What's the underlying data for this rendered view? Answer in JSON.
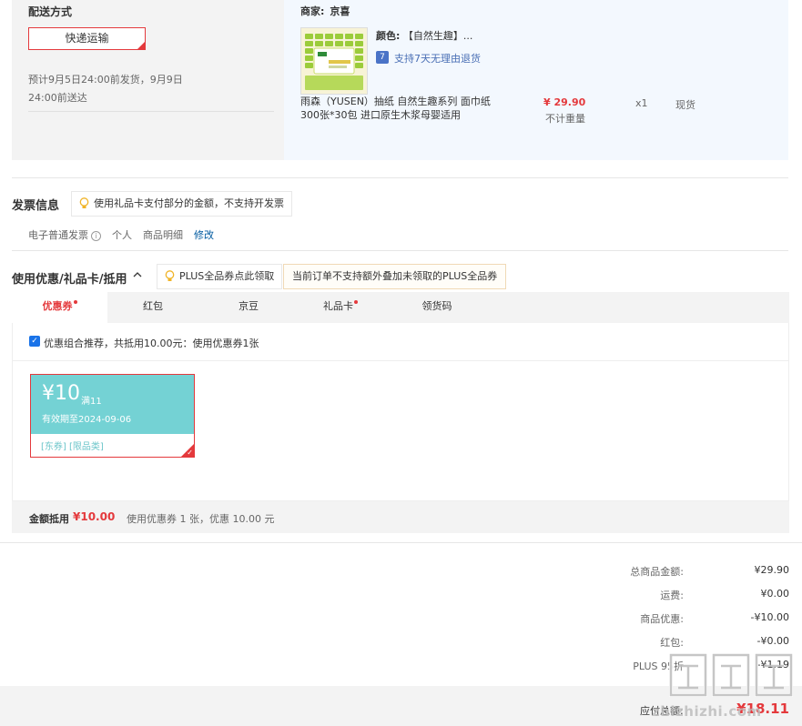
{
  "delivery": {
    "title": "配送方式",
    "method": "快递运输",
    "eta_line1": "预计9月5日24:00前发货，9月9日",
    "eta_line2": "24:00前送达"
  },
  "merchant": {
    "label": "商家:",
    "name": "京喜"
  },
  "product": {
    "color_label": "颜色:",
    "color_value": "【自然生趣】...",
    "return_icon": "7",
    "return_policy": "支持7天无理由退货",
    "name": "雨森（YUSEN）抽纸 自然生趣系列 面巾纸300张*30包 进口原生木浆母婴适用",
    "price": "¥ 29.90",
    "weight": "不计重量",
    "qty": "x1",
    "stock": "现货",
    "thumb_icon": "tissue-pack-image"
  },
  "invoice": {
    "title": "发票信息",
    "tip": "使用礼品卡支付部分的金额，不支持开发票",
    "type": "电子普通发票",
    "info_icon": "i",
    "holder": "个人",
    "content": "商品明细",
    "edit": "修改"
  },
  "coupons": {
    "title": "使用优惠/礼品卡/抵用",
    "plus_tip": "PLUS全品券点此领取",
    "plus_notice": "当前订单不支持额外叠加未领取的PLUS全品券",
    "tabs": [
      {
        "label": "优惠券",
        "dot": true
      },
      {
        "label": "红包",
        "dot": false
      },
      {
        "label": "京豆",
        "dot": false
      },
      {
        "label": "礼品卡",
        "dot": true
      },
      {
        "label": "领货码",
        "dot": false
      }
    ],
    "checkbox_mark": "✓",
    "recommend": "优惠组合推荐，共抵用10.00元：使用优惠券1张",
    "card": {
      "amount": "¥10",
      "condition": "满11",
      "valid": "有效期至2024-09-06",
      "tags": "[东券]  [限品类]",
      "tick": "✓"
    },
    "footer_label": "金额抵用",
    "footer_amount": "¥10.00",
    "footer_desc": "使用优惠券 1 张，优惠 10.00 元"
  },
  "summary": {
    "rows": [
      {
        "label": "总商品金额:",
        "value": "¥29.90"
      },
      {
        "label": "运费:",
        "value": "¥0.00"
      },
      {
        "label": "商品优惠:",
        "value": "-¥10.00"
      },
      {
        "label": "红包:",
        "value": "-¥0.00"
      },
      {
        "label": "PLUS 95折",
        "value": "-¥1.19"
      }
    ],
    "pay_label": "应付总额:",
    "pay_value": "¥18.11"
  },
  "watermark": {
    "text": "zhizhizhi.com"
  },
  "colors": {
    "accent_red": "#e4393c",
    "coupon_teal": "#74d2d4",
    "link_blue": "#005aa0"
  }
}
